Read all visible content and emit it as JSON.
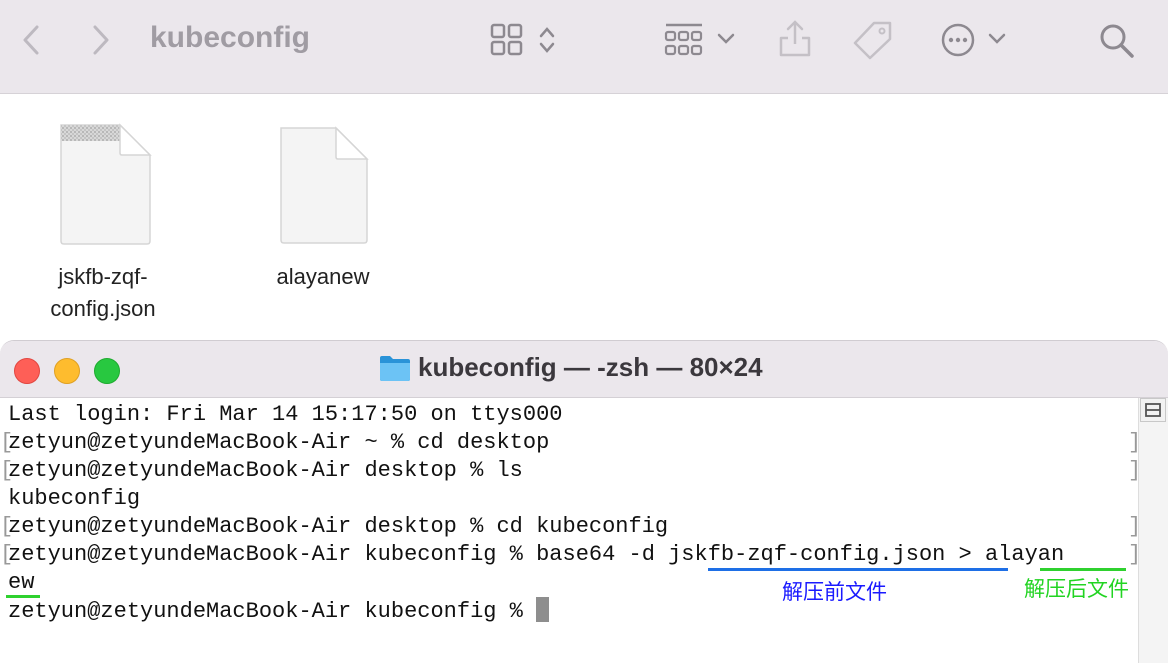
{
  "finder": {
    "title": "kubeconfig",
    "files": [
      {
        "line1": "jskfb-zqf-",
        "line2": "config.json"
      },
      {
        "line1": "alayanew",
        "line2": ""
      }
    ]
  },
  "terminal": {
    "title": "kubeconfig — -zsh — 80×24",
    "lines": [
      "Last login: Fri Mar 14 15:17:50 on ttys000",
      "zetyun@zetyundeMacBook-Air ~ % cd desktop",
      "zetyun@zetyundeMacBook-Air desktop % ls",
      "kubeconfig",
      "zetyun@zetyundeMacBook-Air desktop % cd kubeconfig",
      "zetyun@zetyundeMacBook-Air kubeconfig % base64 -d jskfb-zqf-config.json > alayan",
      "ew",
      "zetyun@zetyundeMacBook-Air kubeconfig % "
    ],
    "bracket_left": "[",
    "bracket_right": "]"
  },
  "annotations": {
    "before": "解压前文件",
    "after": "解压后文件"
  },
  "colors": {
    "annotation_blue": "#1a1aff",
    "annotation_green": "#22d422",
    "underline_blue": "#1e6fe6",
    "underline_green": "#2fd12f",
    "close": "#fe5f57",
    "minimize": "#febc2e",
    "zoom": "#28c840"
  }
}
